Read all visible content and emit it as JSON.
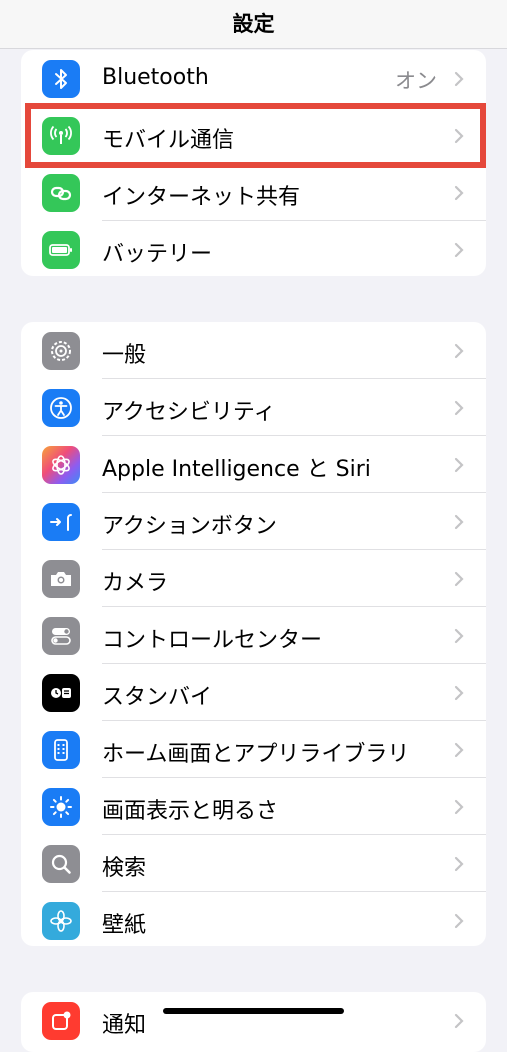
{
  "nav": {
    "title": "設定"
  },
  "group1": [
    {
      "label": "Bluetooth",
      "value": "オン",
      "icon": "bluetooth-icon",
      "color": "#1a7cf5"
    },
    {
      "label": "モバイル通信",
      "value": "",
      "icon": "antenna-icon",
      "color": "#34c759"
    },
    {
      "label": "インターネット共有",
      "value": "",
      "icon": "link-icon",
      "color": "#34c759"
    },
    {
      "label": "バッテリー",
      "value": "",
      "icon": "battery-icon",
      "color": "#34c759"
    }
  ],
  "group2": [
    {
      "label": "一般",
      "icon": "gear-icon",
      "color": "#8e8e93"
    },
    {
      "label": "アクセシビリティ",
      "icon": "accessibility-icon",
      "color": "#1a7cf5"
    },
    {
      "label": "Apple Intelligence と Siri",
      "icon": "apple-intelligence-icon",
      "color": "#8e5cf0"
    },
    {
      "label": "アクションボタン",
      "icon": "action-button-icon",
      "color": "#1a7cf5"
    },
    {
      "label": "カメラ",
      "icon": "camera-icon",
      "color": "#8e8e93"
    },
    {
      "label": "コントロールセンター",
      "icon": "toggles-icon",
      "color": "#8e8e93"
    },
    {
      "label": "スタンバイ",
      "icon": "standby-icon",
      "color": "#000000"
    },
    {
      "label": "ホーム画面とアプリライブラリ",
      "icon": "home-screen-icon",
      "color": "#1a7cf5"
    },
    {
      "label": "画面表示と明るさ",
      "icon": "brightness-icon",
      "color": "#1a7cf5"
    },
    {
      "label": "検索",
      "icon": "search-icon",
      "color": "#8e8e93"
    },
    {
      "label": "壁紙",
      "icon": "wallpaper-icon",
      "color": "#34aadc"
    }
  ],
  "group3": [
    {
      "label": "通知",
      "icon": "notifications-icon",
      "color": "#ff3b30"
    }
  ]
}
